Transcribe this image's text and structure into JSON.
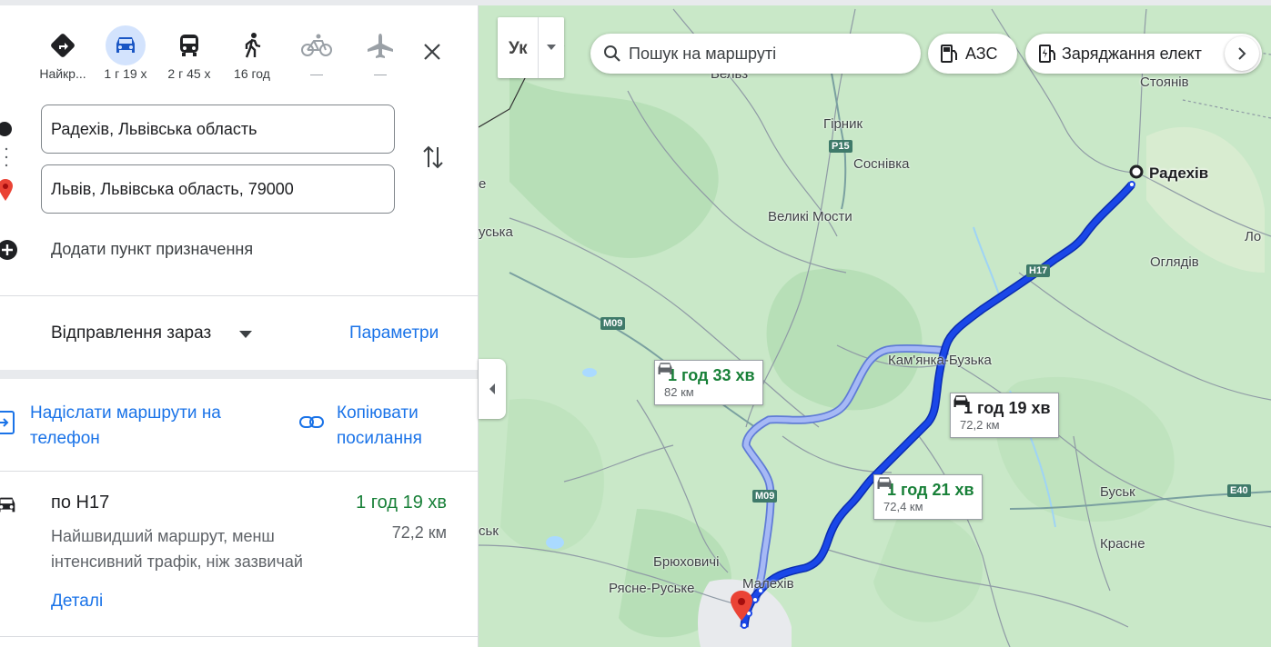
{
  "modes": [
    {
      "name": "best",
      "label": "Найкр..."
    },
    {
      "name": "driving",
      "label": "1 г 19 х"
    },
    {
      "name": "transit",
      "label": "2 г 45 х"
    },
    {
      "name": "walking",
      "label": "16 год"
    },
    {
      "name": "cycling",
      "label": "—"
    },
    {
      "name": "flights",
      "label": "—"
    }
  ],
  "origin_value": "Радехів, Львівська область",
  "destination_value": "Львів, Львівська область, 79000",
  "add_destination": "Додати пункт призначення",
  "depart_label": "Відправлення зараз",
  "options_label": "Параметри",
  "send_to_phone": [
    "Надіслати маршрути на",
    "телефон"
  ],
  "copy_link": [
    "Копіювати",
    "посилання"
  ],
  "route": {
    "title": "по H17",
    "time": "1 год 19 хв",
    "desc": "Найшвидший маршрут, менш інтенсивний трафік, ніж зазвичай",
    "distance": "72,2 км",
    "details": "Деталі"
  },
  "map": {
    "layer_label": "Ук",
    "search_placeholder": "Пошук на маршруті",
    "chip_gas": "АЗС",
    "chip_ev": "Заряджання елект",
    "origin_label": "Радехів",
    "places": [
      "Бельз",
      "Гірник",
      "Соснівка",
      "Стоянів",
      "Великі Мости",
      "Оглядів",
      "Кам'янка-Бузька",
      "Буськ",
      "Красне",
      "Брюховичі",
      "Малехів",
      "Рясне-Руське",
      "Ло",
      "уська",
      "ськ",
      "е"
    ],
    "roads": [
      "P15",
      "H17",
      "M09",
      "M09",
      "E40"
    ],
    "bubbles": [
      {
        "time": "1 год 33 хв",
        "dist": "82 км",
        "selected": false
      },
      {
        "time": "1 год 19 хв",
        "dist": "72,2 км",
        "selected": true
      },
      {
        "time": "1 год 21 хв",
        "dist": "72,4 км",
        "selected": false
      }
    ],
    "colors": {
      "route_selected": "#0b3be6",
      "route_alt": "#a6b9f5",
      "accent": "#1a73e8",
      "green_time": "#188038"
    }
  }
}
